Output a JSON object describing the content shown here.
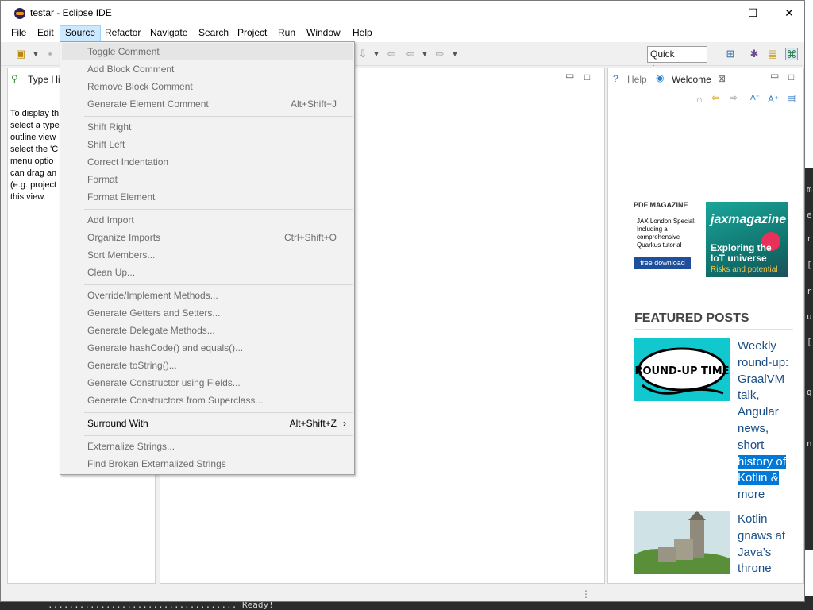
{
  "window": {
    "title": "testar - Eclipse IDE"
  },
  "window_controls": {
    "minimize": "—",
    "maximize": "☐",
    "close": "✕"
  },
  "menubar": [
    "File",
    "Edit",
    "Source",
    "Refactor",
    "Navigate",
    "Search",
    "Project",
    "Run",
    "Window",
    "Help"
  ],
  "toolbar": {
    "quick_access": "Quick Access"
  },
  "left_panel": {
    "tab": "Type Hi",
    "body": [
      "To display th",
      "select a type",
      "outline view",
      "select the 'C",
      "menu optio",
      "can drag an",
      "(e.g. project",
      "this view."
    ]
  },
  "right_panel": {
    "tab_help": "Help",
    "tab_welcome": "Welcome"
  },
  "source_menu": {
    "items": [
      {
        "label": "Toggle Comment",
        "accel": ""
      },
      {
        "label": "Add Block Comment",
        "accel": ""
      },
      {
        "label": "Remove Block Comment",
        "accel": ""
      },
      {
        "label": "Generate Element Comment",
        "accel": "Alt+Shift+J"
      },
      {
        "label": "Shift Right",
        "accel": ""
      },
      {
        "label": "Shift Left",
        "accel": ""
      },
      {
        "label": "Correct Indentation",
        "accel": ""
      },
      {
        "label": "Format",
        "accel": ""
      },
      {
        "label": "Format Element",
        "accel": ""
      },
      {
        "label": "Add Import",
        "accel": ""
      },
      {
        "label": "Organize Imports",
        "accel": "Ctrl+Shift+O"
      },
      {
        "label": "Sort Members...",
        "accel": ""
      },
      {
        "label": "Clean Up...",
        "accel": ""
      },
      {
        "label": "Override/Implement Methods...",
        "accel": ""
      },
      {
        "label": "Generate Getters and Setters...",
        "accel": ""
      },
      {
        "label": "Generate Delegate Methods...",
        "accel": ""
      },
      {
        "label": "Generate hashCode() and equals()...",
        "accel": ""
      },
      {
        "label": "Generate toString()...",
        "accel": ""
      },
      {
        "label": "Generate Constructor using Fields...",
        "accel": ""
      },
      {
        "label": "Generate Constructors from Superclass...",
        "accel": ""
      },
      {
        "label": "Surround With",
        "accel": "Alt+Shift+Z",
        "arrow": "›"
      },
      {
        "label": "Externalize Strings...",
        "accel": ""
      },
      {
        "label": "Find Broken Externalized Strings",
        "accel": ""
      }
    ]
  },
  "welcome": {
    "magazine_label": "PDF MAGAZINE",
    "magazine_desc": "JAX London Special: Including a comprehensive Quarkus tutorial",
    "magazine_button": "free download",
    "cover_logo": "jaxmagazine",
    "cover_headline": "Exploring the IoT universe",
    "cover_sub": "Risks and potential",
    "featured_heading": "FEATURED POSTS",
    "post1_img_text": "ROUND-UP TIME",
    "post1_title_a": "Weekly round-up: GraalVM talk, Angular news, short",
    "post1_title_hl": "history of Kotlin &",
    "post1_title_b": "more",
    "post2_title": "Kotlin gnaws at Java’s throne"
  },
  "console": {
    "bottom_text": ".................................... Ready!"
  }
}
